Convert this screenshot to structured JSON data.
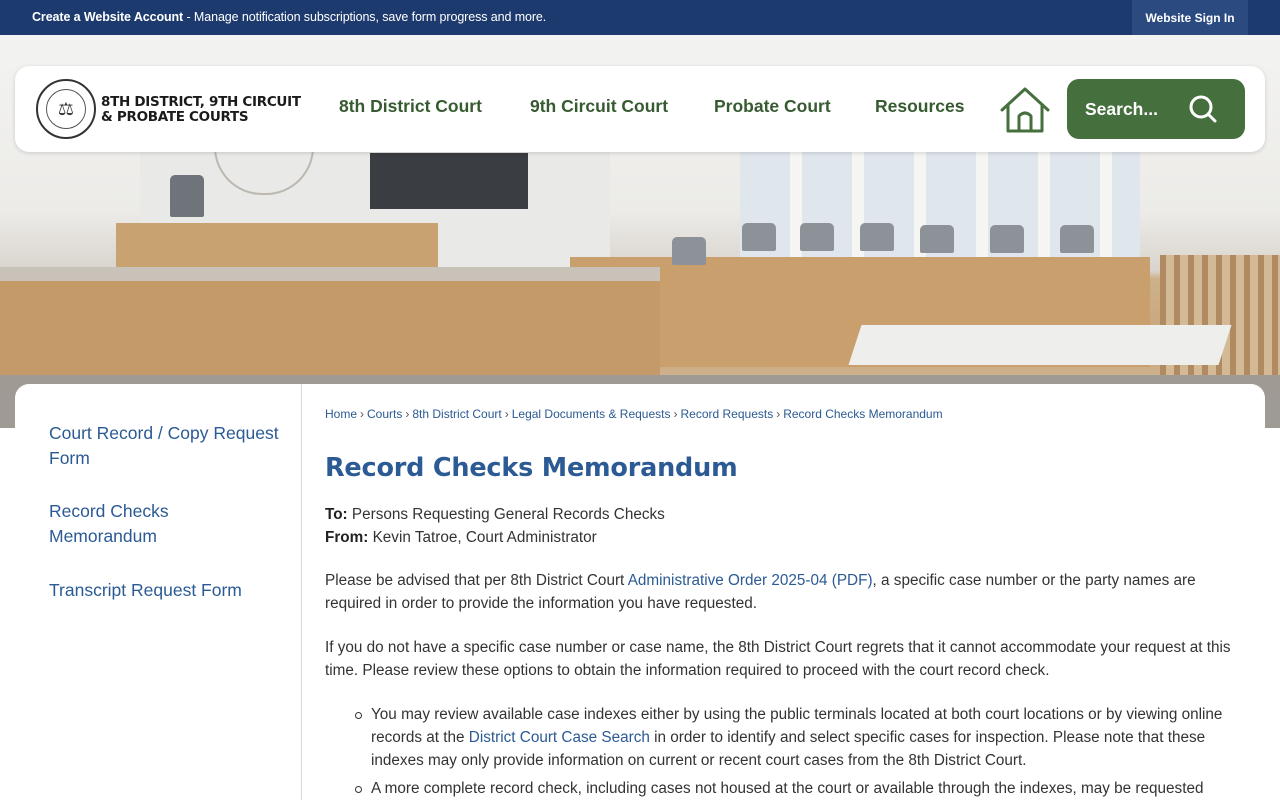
{
  "topbar": {
    "account_strong": "Create a Website Account",
    "account_rest": " - Manage notification subscriptions, save form progress and more.",
    "signin_label": "Website Sign In"
  },
  "header": {
    "logo_line1": "8TH DISTRICT, 9TH CIRCUIT",
    "logo_line2": "& PROBATE COURTS",
    "nav": [
      "8th District Court",
      "9th Circuit Court",
      "Probate Court",
      "Resources"
    ],
    "search_placeholder": "Search..."
  },
  "sidebar": {
    "items": [
      "Court Record / Copy Request Form",
      "Record Checks Memorandum",
      "Transcript Request Form"
    ]
  },
  "breadcrumb": [
    "Home",
    "Courts",
    "8th District Court",
    "Legal Documents & Requests",
    "Record Requests",
    "Record Checks Memorandum"
  ],
  "page": {
    "title": "Record Checks Memorandum",
    "to_label": "To:",
    "to_value": " Persons Requesting General Records Checks",
    "from_label": "From:",
    "from_value": " Kevin Tatroe, Court Administrator",
    "p1_before": "Please be advised that per 8th District Court ",
    "p1_link": "Administrative Order 2025-04 (PDF)",
    "p1_after": ", a specific case number or the party names are required in order to provide the information you have requested.",
    "p2": "If you do not have a specific case number or case name, the 8th District Court regrets that it cannot accommodate your request at this time. Please review these options to obtain the information required to proceed with the court record check.",
    "b1_before": "You may review available case indexes either by using the public terminals located at both court locations or by viewing online records at the ",
    "b1_link": "District Court Case Search",
    "b1_after": " in order to identify and select specific cases for inspection. Please note that these indexes may only provide information on current or recent court cases from the 8th District Court.",
    "b2": "A more complete record check, including cases not housed at the court or available through the indexes, may be requested"
  },
  "colors": {
    "topbar": "#1d3a6e",
    "nav_green": "#365b30",
    "search_bg": "#466f3e",
    "link_blue": "#2b5a94"
  }
}
